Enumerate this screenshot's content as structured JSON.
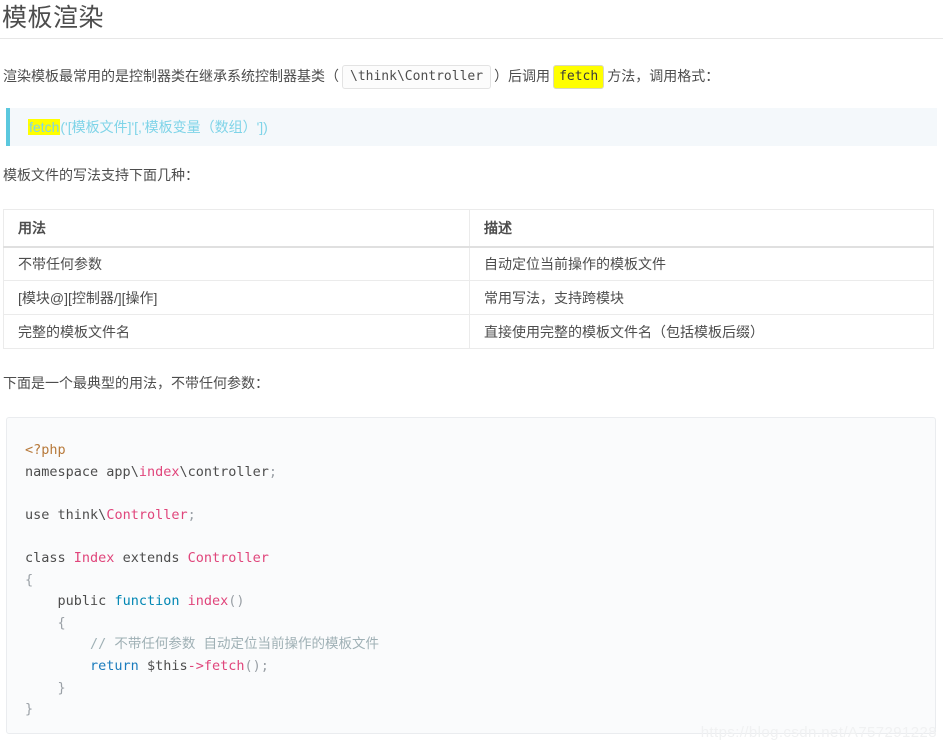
{
  "page": {
    "title": "模板渲染",
    "watermark": "https://blog.csdn.net/A757291228"
  },
  "intro": {
    "part1": "渲染模板最常用的是控制器类在继承系统控制器基类（",
    "code_controller": "\\think\\Controller",
    "part2": "）后调用",
    "code_fetch": "fetch",
    "part3": "方法，调用格式："
  },
  "note": {
    "highlight": "fetch",
    "rest": "('[模板文件]'[,'模板变量（数组）'])"
  },
  "usage_intro": "模板文件的写法支持下面几种：",
  "table": {
    "headers": [
      "用法",
      "描述"
    ],
    "rows": [
      [
        "不带任何参数",
        "自动定位当前操作的模板文件"
      ],
      [
        "[模块@][控制器/][操作]",
        "常用写法，支持跨模块"
      ],
      [
        "完整的模板文件名",
        "直接使用完整的模板文件名（包括模板后缀）"
      ]
    ]
  },
  "example_intro": "下面是一个最典型的用法，不带任何参数：",
  "code": {
    "language": "php",
    "lines": [
      "<?php",
      "namespace app\\index\\controller;",
      "",
      "use think\\Controller;",
      "",
      "class Index extends Controller",
      "{",
      "    public function index()",
      "    {",
      "        // 不带任何参数 自动定位当前操作的模板文件",
      "        return $this->fetch();",
      "    }",
      "}"
    ]
  },
  "colors": {
    "text": "#4d4d4d",
    "note_bg": "#f4f8fb",
    "note_border": "#5bc8de",
    "note_text": "#7fd4e8",
    "highlight": "#ffff00",
    "code_bg": "#fafbfc",
    "code_border": "#eaecef",
    "table_border": "#ebebeb",
    "token_tag": "#b7793a",
    "token_function": "#0086b3",
    "token_return": "#1a7bbd",
    "token_name": "#e0457b",
    "token_comment": "#9fb0b5",
    "watermark": "#f0f1f2"
  }
}
